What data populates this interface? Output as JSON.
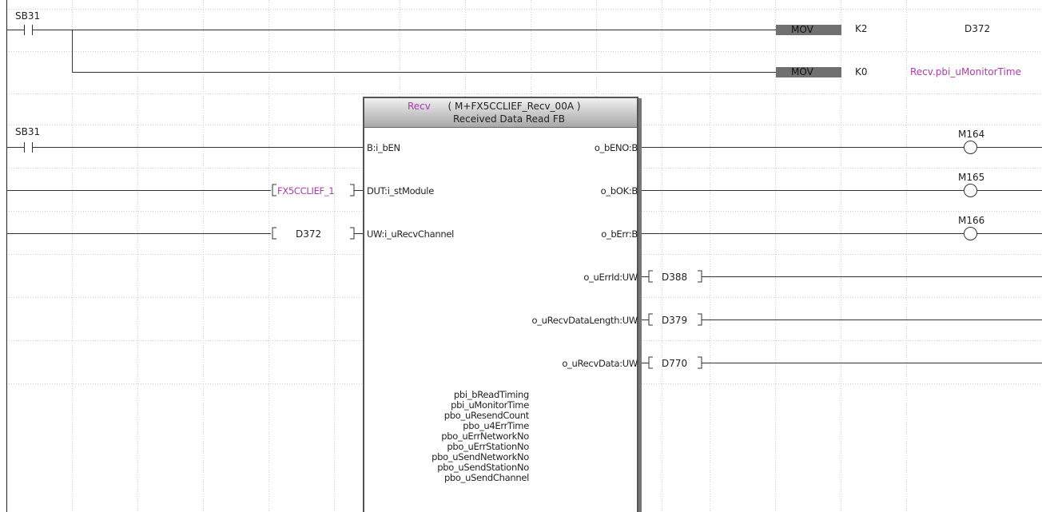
{
  "rung1": {
    "contact_label": "SB31",
    "mov1": {
      "instr": "MOV",
      "src": "K2",
      "dst": "D372"
    },
    "mov2": {
      "instr": "MOV",
      "src": "K0",
      "dst": "Recv.pbi_uMonitorTime"
    }
  },
  "rung2": {
    "contact_label": "SB31",
    "fb": {
      "instance": "Recv",
      "type": "( M+FX5CCLIEF_Recv_00A )",
      "description": "Received Data Read FB",
      "inputs": [
        {
          "pin": "B:i_bEN",
          "operand": ""
        },
        {
          "pin": "DUT:i_stModule",
          "operand": "FX5CCLIEF_1"
        },
        {
          "pin": "UW:i_uRecvChannel",
          "operand": "D372"
        }
      ],
      "outputs": [
        {
          "pin": "o_bENO:B",
          "coil": "M164"
        },
        {
          "pin": "o_bOK:B",
          "coil": "M165"
        },
        {
          "pin": "o_bErr:B",
          "coil": "M166"
        },
        {
          "pin": "o_uErrId:UW",
          "operand": "D388"
        },
        {
          "pin": "o_uRecvDataLength:UW",
          "operand": "D379"
        },
        {
          "pin": "o_uRecvData:UW",
          "operand": "D770"
        }
      ],
      "public_vars": [
        "pbi_bReadTiming",
        "pbi_uMonitorTime",
        "pbo_uResendCount",
        "pbo_u4ErrTime",
        "pbo_uErrNetworkNo",
        "pbo_uErrStationNo",
        "pbo_uSendNetworkNo",
        "pbo_uSendStationNo",
        "pbo_uSendChannel"
      ]
    }
  }
}
